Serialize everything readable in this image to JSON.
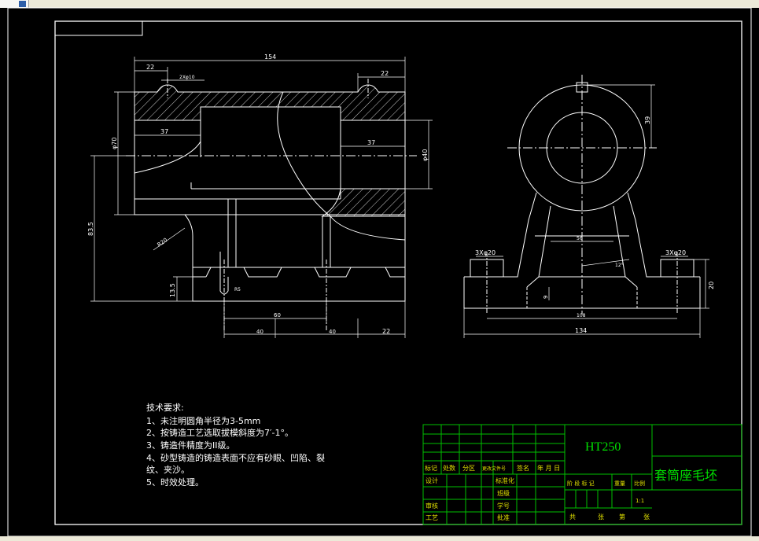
{
  "dimensions": {
    "overall_length": "154",
    "left_boss": "22",
    "left_hole": "2Xφ10",
    "right_boss": "22",
    "bore_left": "37",
    "outer_dia": "φ70",
    "bore_right": "37",
    "inner_dia": "φ40",
    "height": "83.5",
    "fillet": "R20",
    "base_thick": "13.5",
    "slot_r": "R5",
    "slot_span": "60",
    "bottom_a": "40",
    "bottom_b": "40",
    "bottom_c": "22"
  },
  "side_view": {
    "top_dim": "39",
    "hole_left": "3Xφ20",
    "hole_right": "3Xφ20",
    "rib_width": "56",
    "angle": "12°",
    "rib_gap": "9",
    "base_h": "20",
    "inner_span": "108",
    "total_width": "134"
  },
  "tech": {
    "title": "技术要求:",
    "lines": [
      "1、未注明圆角半径为3-5mm",
      "2、按铸造工艺选取拔模斜度为7′-1°。",
      "3、铸造件精度为II级。",
      "4、砂型铸造的铸造表面不应有砂眼、凹陷、裂",
      "纹、夹沙。",
      "5、时效处理。"
    ]
  },
  "title_block": {
    "material": "HT250",
    "part_name": "套筒座毛坯",
    "header_cells": [
      "标记",
      "处数",
      "分区",
      "更改文件号",
      "签名",
      "年 月 日"
    ],
    "left_labels": [
      "设计",
      "",
      "审核",
      "工艺"
    ],
    "mid_labels": [
      "标准化",
      "班级",
      "学号",
      "批准"
    ],
    "stage_cells": [
      "阶 段 标 记",
      "重量",
      "比例"
    ],
    "scale": "1:1",
    "sheet_cells": [
      "共",
      "张",
      "第",
      "张"
    ]
  }
}
